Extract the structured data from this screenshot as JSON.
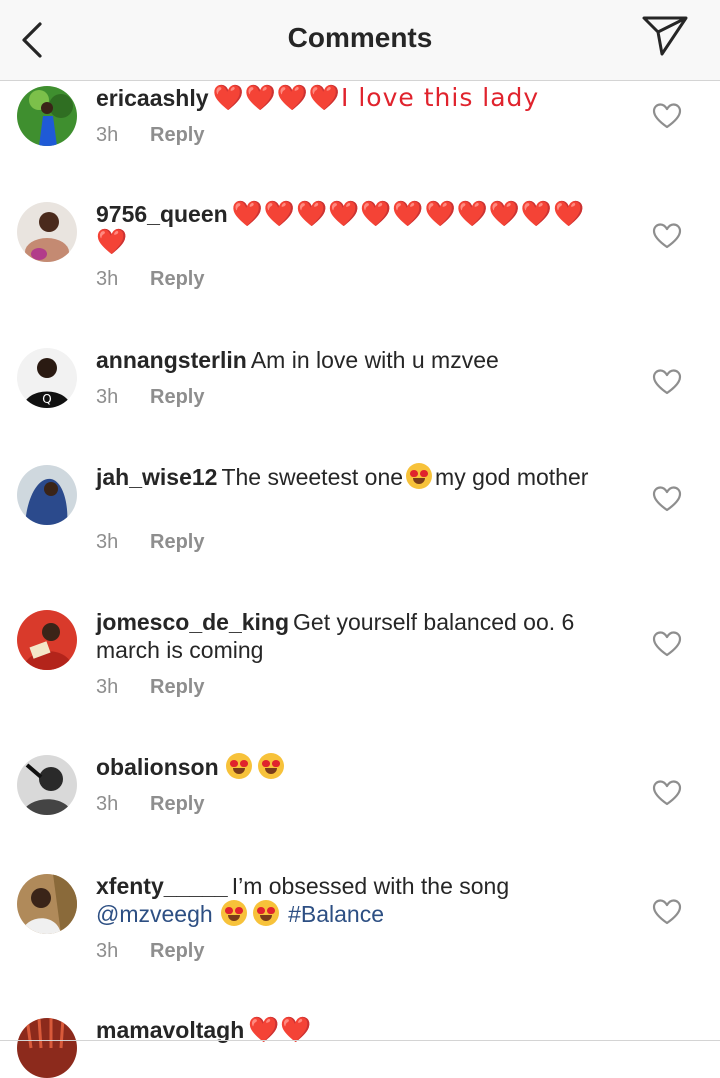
{
  "header": {
    "title": "Comments"
  },
  "comments": [
    {
      "username": "ericaashly",
      "text": "❤️❤️❤️❤️I love this lady",
      "time": "3h",
      "reply": "Reply",
      "avatar_color": "#3a7d2c"
    },
    {
      "username": "9756_queen",
      "text": "❤️❤️❤️❤️❤️❤️❤️❤️❤️❤️❤️❤️",
      "time": "3h",
      "reply": "Reply",
      "avatar_color": "#c9a98f"
    },
    {
      "username": "annangsterlin",
      "text": "Am in love with u mzvee",
      "time": "3h",
      "reply": "Reply",
      "avatar_color": "#1b1b1b"
    },
    {
      "username": "jah_wise12",
      "text_before": "The sweetest one",
      "text_after": "my god mother",
      "time": "3h",
      "reply": "Reply",
      "avatar_color": "#2b4a8c"
    },
    {
      "username": "jomesco_de_king",
      "text": "Get yourself balanced oo. 6 march is coming",
      "time": "3h",
      "reply": "Reply",
      "avatar_color": "#c0392b"
    },
    {
      "username": "obalionson",
      "time": "3h",
      "reply": "Reply",
      "avatar_color": "#555555"
    },
    {
      "username": "xfenty_____",
      "text": "I’m obsessed with the song",
      "mention": "@mzveegh",
      "hashtag": "#Balance",
      "time": "3h",
      "reply": "Reply",
      "avatar_color": "#8a6a3a"
    },
    {
      "username": "mamavoltagh",
      "text": "❤️❤️",
      "avatar_color": "#8c2a1c"
    }
  ]
}
